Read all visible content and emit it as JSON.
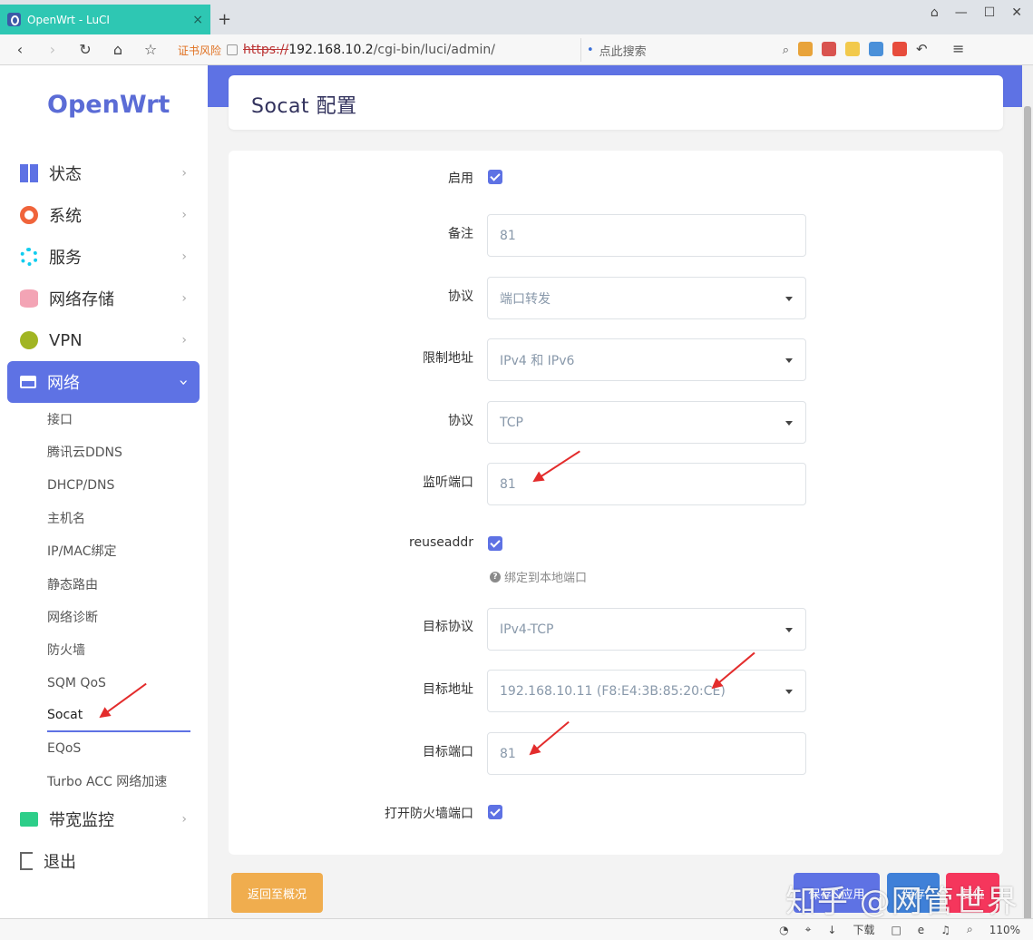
{
  "browser": {
    "tab_title": "OpenWrt - LuCI",
    "tab_close": "×",
    "new_tab": "+",
    "cert_warning": "证书风险",
    "url_scheme": "https://",
    "url_host": "192.168.10.2",
    "url_path": "/cgi-bin/luci/admin/",
    "search_placeholder": "点此搜索",
    "window_controls": [
      "⌂",
      "—",
      "☐",
      "✕"
    ]
  },
  "sidebar": {
    "logo": "OpenWrt",
    "menu": [
      {
        "label": "状态",
        "icon": "dashboard-icon",
        "color": "#5e72e4"
      },
      {
        "label": "系统",
        "icon": "gear-icon",
        "color": "#f0643b"
      },
      {
        "label": "服务",
        "icon": "services-icon",
        "color": "#11cdef"
      },
      {
        "label": "网络存储",
        "icon": "database-icon",
        "color": "#f3a4b5"
      },
      {
        "label": "VPN",
        "icon": "globe-icon",
        "color": "#a1b523"
      }
    ],
    "network": {
      "label": "网络",
      "icon": "sitemap-icon"
    },
    "network_sub": [
      "接口",
      "腾讯云DDNS",
      "DHCP/DNS",
      "主机名",
      "IP/MAC绑定",
      "静态路由",
      "网络诊断",
      "防火墙",
      "SQM QoS",
      "Socat",
      "EQoS",
      "Turbo ACC 网络加速"
    ],
    "bottom": [
      {
        "label": "带宽监控",
        "icon": "monitor-icon",
        "color": "#2dce89"
      },
      {
        "label": "退出",
        "icon": "logout-icon",
        "color": "#666666"
      }
    ]
  },
  "page": {
    "title": "Socat 配置"
  },
  "form": {
    "enable_label": "启用",
    "remark_label": "备注",
    "remark_value": "81",
    "protocol_label": "协议",
    "protocol_value": "端口转发",
    "restrict_label": "限制地址",
    "restrict_value": "IPv4 和 IPv6",
    "proto2_label": "协议",
    "proto2_value": "TCP",
    "listen_port_label": "监听端口",
    "listen_port_value": "81",
    "reuseaddr_label": "reuseaddr",
    "reuseaddr_hint": "绑定到本地端口",
    "target_proto_label": "目标协议",
    "target_proto_value": "IPv4-TCP",
    "target_addr_label": "目标地址",
    "target_addr_value": "192.168.10.11 (F8:E4:3B:85:20:CE)",
    "target_port_label": "目标端口",
    "target_port_value": "81",
    "open_fw_label": "打开防火墙端口"
  },
  "buttons": {
    "back": "返回至概况",
    "save_apply": "保存&应用",
    "save": "保存",
    "reset": "复位"
  },
  "watermark": "知乎 @网管世界",
  "statusbar": {
    "download": "下载",
    "zoom": "110%"
  }
}
